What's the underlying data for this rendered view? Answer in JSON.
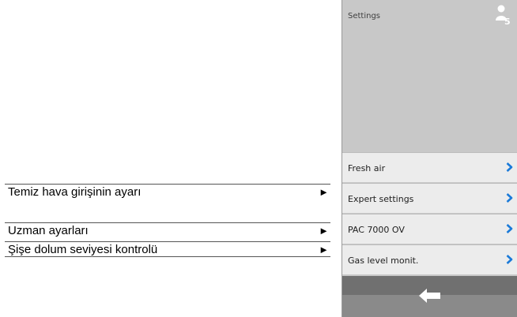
{
  "annotations": [
    {
      "text": "Temiz hava girişinin ayarı",
      "arrow": "►"
    },
    {
      "text": "Uzman ayarları",
      "arrow": "►"
    },
    {
      "text": "Şişe dolum seviyesi kontrolü",
      "arrow": "►"
    }
  ],
  "screen": {
    "title": "Settings",
    "user_level": "5",
    "menu": [
      {
        "label": "Fresh air"
      },
      {
        "label": "Expert settings"
      },
      {
        "label": "PAC 7000 OV"
      },
      {
        "label": "Gas level monit."
      }
    ]
  },
  "colors": {
    "accent": "#1a7ad9",
    "header_bg": "#c8c8c8",
    "item_bg": "#ececec",
    "footer_bg": "#8a8a8a"
  },
  "icons": {
    "user": "user-level-icon",
    "chevron": "chevron-right-icon",
    "back": "back-arrow-icon"
  }
}
